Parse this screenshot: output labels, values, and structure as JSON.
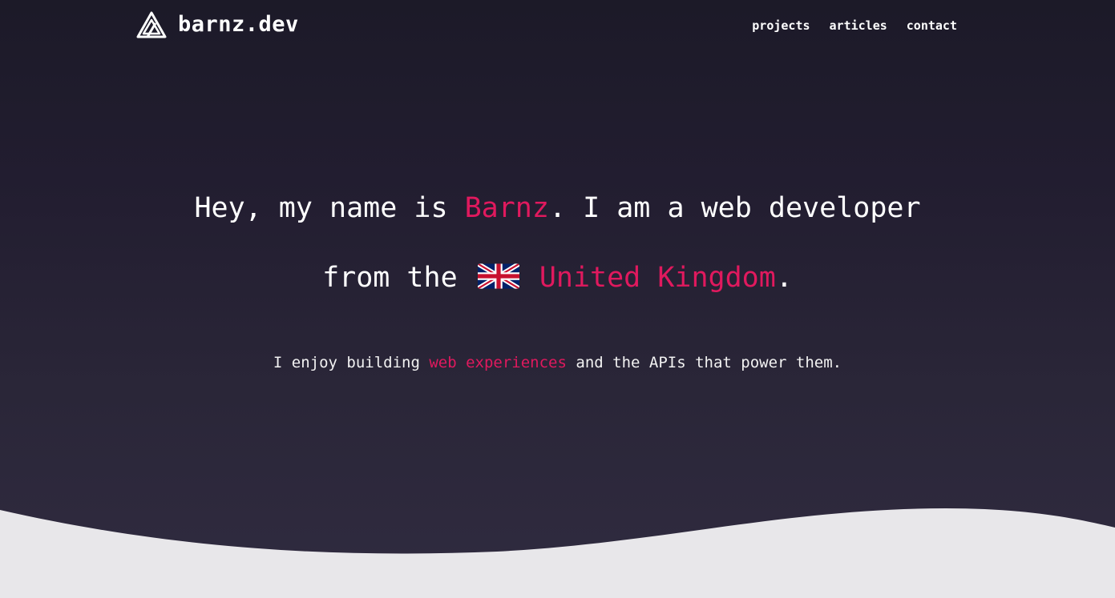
{
  "header": {
    "brand": "barnz.dev",
    "nav": [
      {
        "label": "projects"
      },
      {
        "label": "articles"
      },
      {
        "label": "contact"
      }
    ]
  },
  "hero": {
    "line1": {
      "prefix": "Hey, my name is ",
      "name": "Barnz",
      "suffix": ". I am a web developer"
    },
    "line2": {
      "prefix": "from the ",
      "flag_icon": "uk-flag-icon",
      "country": "United Kingdom",
      "suffix": "."
    },
    "tagline": {
      "prefix": "I enjoy building ",
      "highlight": "web experiences",
      "suffix": " and the APIs that power them."
    }
  },
  "colors": {
    "accent": "#e0195e",
    "background_top": "#1c1a28",
    "background_bottom": "#302b40",
    "wave": "#e8e7ea",
    "text": "#ffffff"
  },
  "icons": {
    "logo": "triangle-logo-icon",
    "flag": "uk-flag-icon"
  }
}
